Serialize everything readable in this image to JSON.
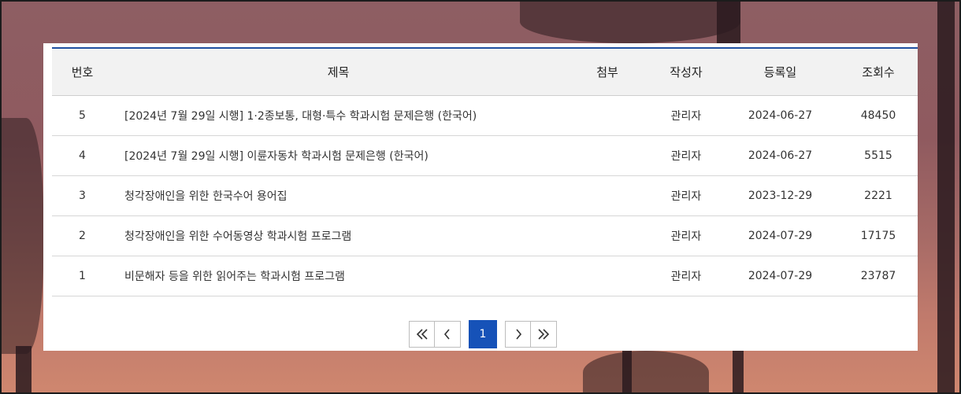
{
  "table": {
    "headers": {
      "no": "번호",
      "title": "제목",
      "attach": "첨부",
      "author": "작성자",
      "date": "등록일",
      "views": "조회수"
    },
    "rows": [
      {
        "no": "5",
        "title": "[2024년 7월 29일 시행] 1·2종보통, 대형·특수 학과시험 문제은행 (한국어)",
        "attach": "",
        "author": "관리자",
        "date": "2024-06-27",
        "views": "48450"
      },
      {
        "no": "4",
        "title": "[2024년 7월 29일 시행] 이륜자동차 학과시험 문제은행 (한국어)",
        "attach": "",
        "author": "관리자",
        "date": "2024-06-27",
        "views": "5515"
      },
      {
        "no": "3",
        "title": "청각장애인을 위한 한국수어 용어집",
        "attach": "",
        "author": "관리자",
        "date": "2023-12-29",
        "views": "2221"
      },
      {
        "no": "2",
        "title": "청각장애인을 위한 수어동영상 학과시험 프로그램",
        "attach": "",
        "author": "관리자",
        "date": "2024-07-29",
        "views": "17175"
      },
      {
        "no": "1",
        "title": "비문해자 등을 위한 읽어주는 학과시험 프로그램",
        "attach": "",
        "author": "관리자",
        "date": "2024-07-29",
        "views": "23787"
      }
    ]
  },
  "pagination": {
    "first_icon": "double-chevron-left-icon",
    "prev_icon": "chevron-left-icon",
    "current_page": "1",
    "next_icon": "chevron-right-icon",
    "last_icon": "double-chevron-right-icon"
  },
  "colors": {
    "accent": "#1652b8",
    "header_border": "#1f4fa0",
    "header_bg": "#f2f2f2"
  }
}
